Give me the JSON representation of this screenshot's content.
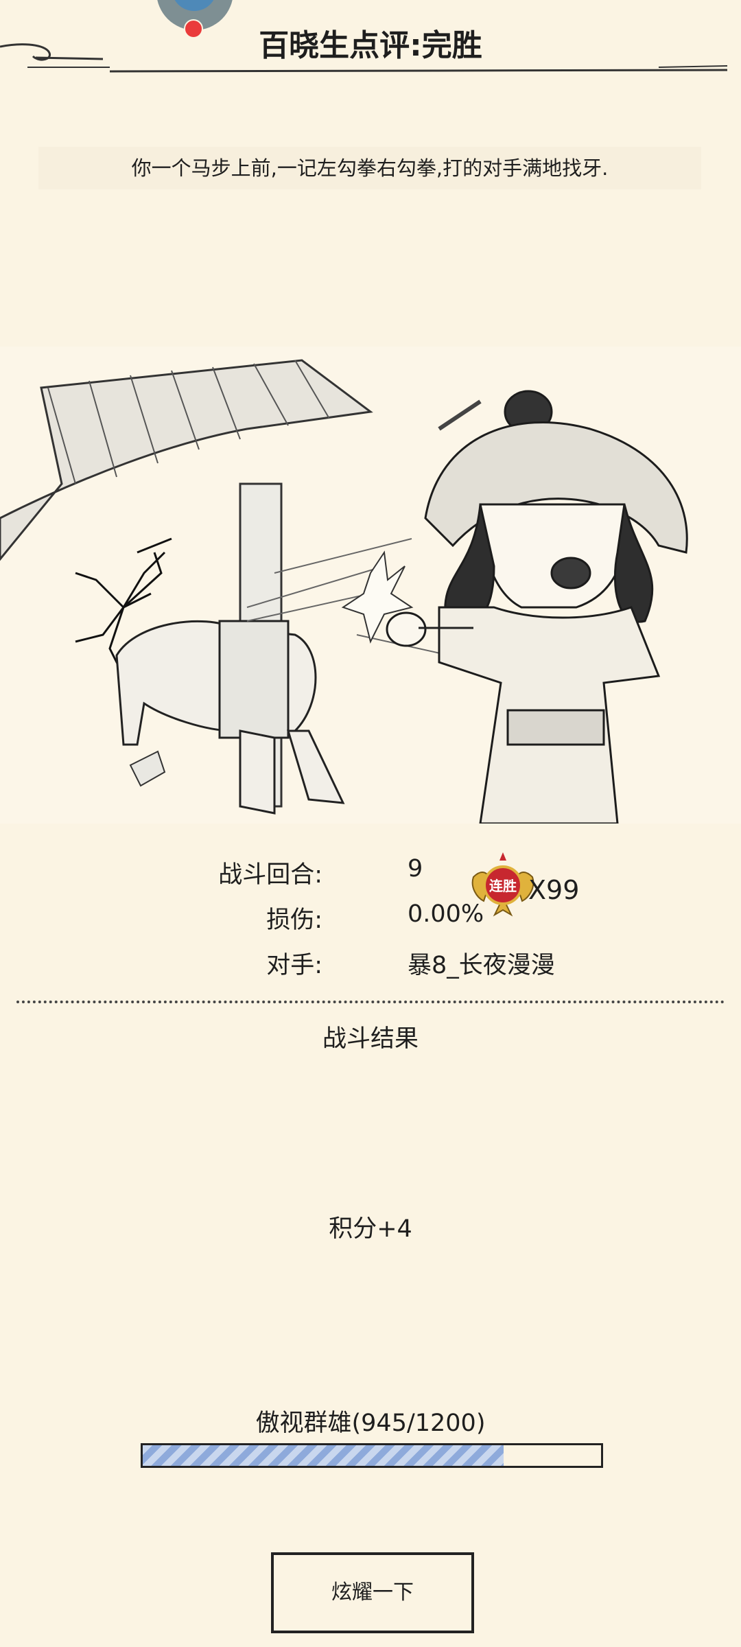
{
  "header": {
    "title": "百晓生点评:完胜"
  },
  "battle": {
    "description": "你一个马步上前,一记左勾拳右勾拳,打的对手满地找牙."
  },
  "stats": {
    "rounds_label": "战斗回合:",
    "rounds_value": "9",
    "damage_label": "损伤:",
    "damage_value": "0.00%",
    "opponent_label": "对手:",
    "opponent_value": "暴8_长夜漫漫"
  },
  "streak": {
    "badge_text": "连胜",
    "count": "X99"
  },
  "result": {
    "title": "战斗结果",
    "score": "积分+4"
  },
  "rank": {
    "label": "傲视群雄(945/1200)",
    "current": 945,
    "max": 1200
  },
  "actions": {
    "share_label": "炫耀一下"
  },
  "colors": {
    "background": "#fbf4e3",
    "progress_fill": "#8eaadb",
    "streak_red": "#c7272f",
    "streak_gold": "#e0b23c"
  }
}
